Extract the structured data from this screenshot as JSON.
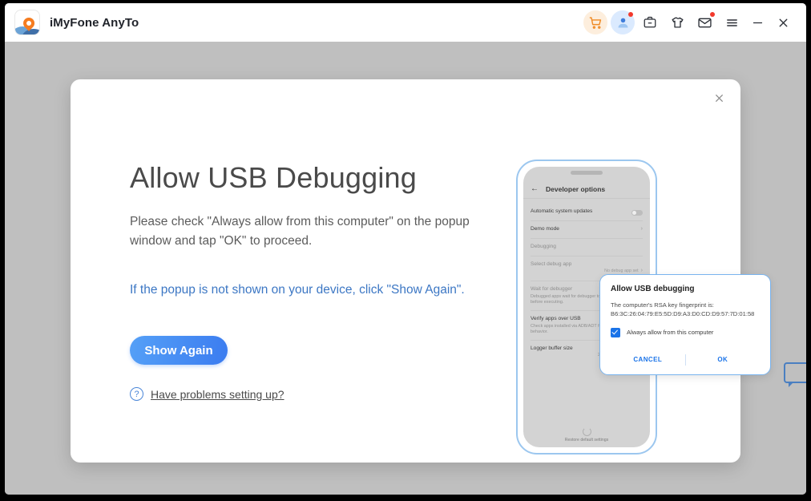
{
  "titlebar": {
    "app_name": "iMyFone AnyTo",
    "logo_icon": "location-pin-logo",
    "actions": [
      {
        "icon": "cart-icon",
        "name": "shop-button",
        "badge": false,
        "style": "bg-orange"
      },
      {
        "icon": "user-icon",
        "name": "account-button",
        "badge": true,
        "style": "bg-blue"
      },
      {
        "icon": "briefcase-icon",
        "name": "products-button",
        "badge": false,
        "style": ""
      },
      {
        "icon": "tshirt-icon",
        "name": "store-button",
        "badge": false,
        "style": ""
      },
      {
        "icon": "envelope-icon",
        "name": "messages-button",
        "badge": true,
        "style": ""
      }
    ],
    "menu_icon": "hamburger-menu-icon",
    "minimize_icon": "minimize-icon",
    "close_icon": "close-icon"
  },
  "modal": {
    "close_icon": "close-icon",
    "headline": "Allow USB Debugging",
    "subtext": "Please check \"Always allow from this computer\" on the popup window and tap \"OK\" to proceed.",
    "hint": "If the popup is not shown on your device, click \"Show Again\".",
    "primary_button": "Show Again",
    "help_icon": "question-circle-icon",
    "help_link": "Have problems setting up?",
    "accent_color": "#3b7cf0",
    "hint_color": "#3c77c4"
  },
  "phone": {
    "screen_title": "Developer options",
    "back_icon": "back-arrow-icon",
    "rows": [
      {
        "label": "Automatic system updates",
        "desc": "",
        "value": "",
        "control": "toggle",
        "dim": false
      },
      {
        "label": "Demo mode",
        "desc": "",
        "value": "",
        "control": "chevron",
        "dim": false
      },
      {
        "label": "Debugging",
        "desc": "",
        "value": "",
        "control": "none",
        "dim": false
      },
      {
        "label": "Select debug app",
        "desc": "",
        "value": "No debug app set",
        "control": "chevron",
        "dim": true
      },
      {
        "label": "Wait for debugger",
        "desc": "Debugged apps wait for debugger to be attached before executing.",
        "value": "",
        "control": "toggle",
        "dim": true
      },
      {
        "label": "Verify apps over USB",
        "desc": "Check apps installed via ADB/ADT for harmful behavior.",
        "value": "",
        "control": "toggle",
        "dim": false
      },
      {
        "label": "Logger buffer size",
        "desc": "",
        "value": "256 KB per log buffer",
        "control": "chevron",
        "dim": false
      }
    ],
    "footer": "Restore default settings",
    "footer_icon": "spinner-icon"
  },
  "adb_dialog": {
    "title": "Allow USB debugging",
    "body_line1": "The computer's RSA key fingerprint is:",
    "body_line2": "B6:3C:26:04:79:E5:5D:D9:A3:D0:CD:D9:57:7D:01:58",
    "checkbox_label": "Always allow from this computer",
    "checkbox_checked": true,
    "checkbox_icon": "checkbox-checked-icon",
    "cancel_label": "CANCEL",
    "ok_label": "OK",
    "button_color": "#1a73e8"
  },
  "side_tab": {
    "icon": "feedback-tab-icon"
  }
}
